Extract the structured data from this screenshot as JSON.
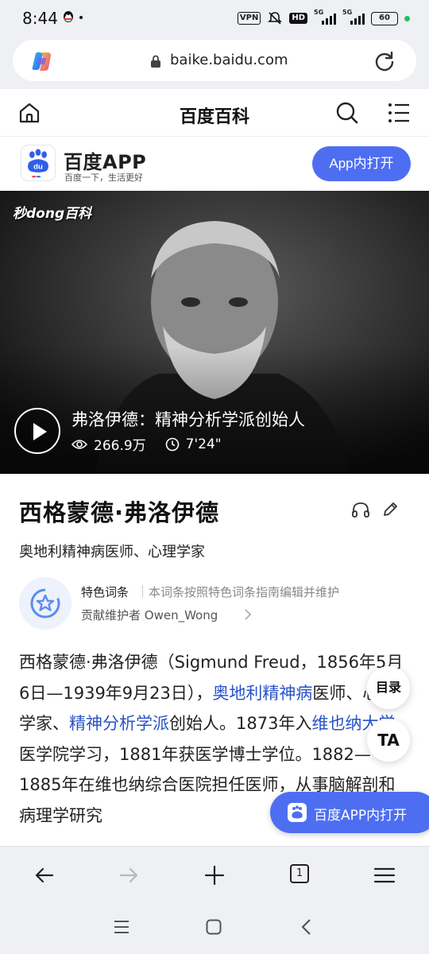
{
  "status_bar": {
    "time": "8:44",
    "vpn": "VPN",
    "hd": "HD",
    "net1": "5G",
    "net2": "5G",
    "battery": "60"
  },
  "browser": {
    "url": "baike.baidu.com",
    "tab_count": "1"
  },
  "header": {
    "title": "百度百科"
  },
  "app_banner": {
    "name": "百度APP",
    "slogan": "百度一下，生活更好",
    "open_label": "App内打开"
  },
  "video": {
    "logo": "秒dong百科",
    "title": "弗洛伊德：精神分析学派创始人",
    "views": "266.9万",
    "duration": "7'24\""
  },
  "entry": {
    "title": "西格蒙德·弗洛伊德",
    "subtitle": "奥地利精神病医师、心理学家",
    "feature_label": "特色词条",
    "feature_desc": "本词条按照特色词条指南编辑并维护",
    "contributor": "贡献维护者 Owen_Wong"
  },
  "body": {
    "t1": "西格蒙德·弗洛伊德（Sigmund Freud，1856年5月6日—1939年9月23日），",
    "link1": "奥地利精神病",
    "t2": "医师、心理学家、",
    "link2": "精神分析学派",
    "t3": "创始人。1873年入",
    "link3": "维也纳大学",
    "t4": "医学院学习，1881年获医学博士学位。1882—1885年在维也纳综合医院担任医师，从事脑解剖和病理学研究"
  },
  "floating": {
    "toc": "目录",
    "ta": "TA",
    "app_open": "百度APP内打开"
  },
  "colors": {
    "accent": "#4e6ef2",
    "link": "#2752c7",
    "bar_bg": "#eef0f3"
  }
}
